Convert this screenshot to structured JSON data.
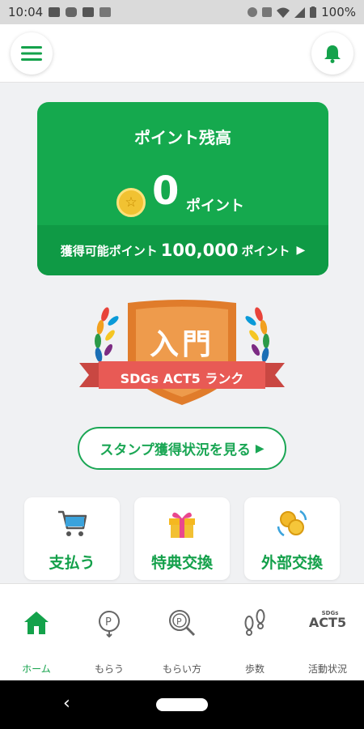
{
  "status_bar": {
    "time": "10:04",
    "battery": "100%"
  },
  "header": {
    "menu_icon": "menu-icon",
    "bell_icon": "bell-icon"
  },
  "point_card": {
    "title": "ポイント残高",
    "value": "0",
    "unit": "ポイント",
    "earnable_label": "獲得可能ポイント",
    "earnable_value": "100,000",
    "earnable_unit": "ポイント",
    "arrow": "▶"
  },
  "rank": {
    "level": "入門",
    "ribbon": "SDGs ACT5 ランク"
  },
  "stamp_button": {
    "label": "スタンプ獲得状況を見る",
    "arrow": "▶"
  },
  "tiles": [
    {
      "label": "支払う",
      "icon": "cart-icon"
    },
    {
      "label": "特典交換",
      "icon": "gift-icon"
    },
    {
      "label": "外部交換",
      "icon": "coins-exchange-icon"
    }
  ],
  "tab_bar": {
    "items": [
      {
        "label": "ホーム",
        "icon": "home-icon",
        "active": true
      },
      {
        "label": "もらう",
        "icon": "point-receive-icon",
        "active": false
      },
      {
        "label": "もらい方",
        "icon": "point-search-icon",
        "active": false
      },
      {
        "label": "歩数",
        "icon": "footprints-icon",
        "active": false
      },
      {
        "label": "活動状況",
        "icon": "act5-logo-icon",
        "active": false
      }
    ],
    "act5_logo_small": "SDGs",
    "act5_logo_big": "ACT5"
  },
  "colors": {
    "primary_green": "#15a94e",
    "dark_green": "#0f9a45",
    "rank_orange": "#e07c2b",
    "ribbon_red": "#e85a55"
  }
}
